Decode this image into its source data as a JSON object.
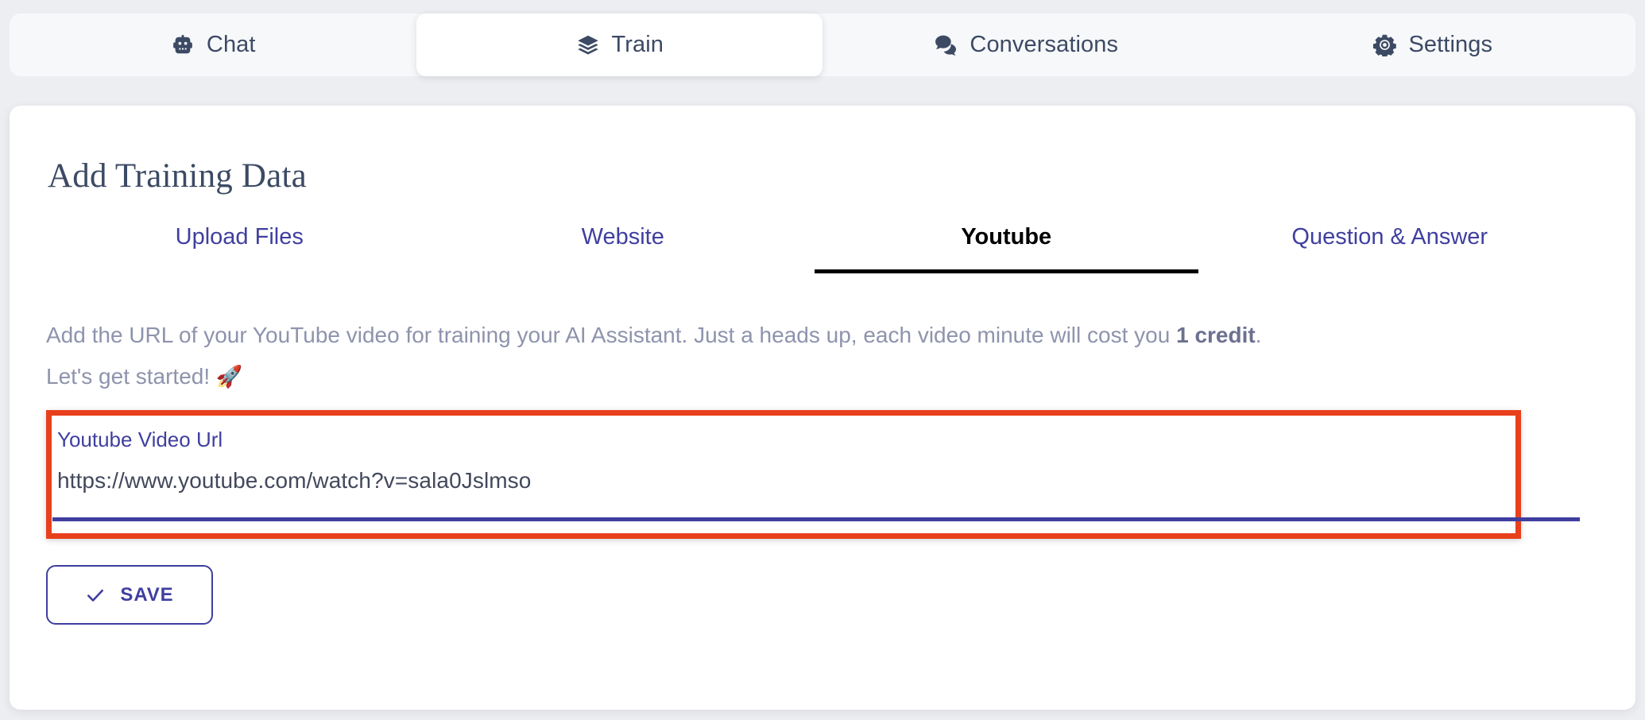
{
  "nav": {
    "tabs": [
      {
        "label": "Chat",
        "icon": "robot-icon",
        "active": false
      },
      {
        "label": "Train",
        "icon": "layers-icon",
        "active": true
      },
      {
        "label": "Conversations",
        "icon": "chat-bubbles-icon",
        "active": false
      },
      {
        "label": "Settings",
        "icon": "gear-icon",
        "active": false
      }
    ]
  },
  "main": {
    "title": "Add Training Data",
    "sub_tabs": [
      {
        "label": "Upload Files",
        "active": false
      },
      {
        "label": "Website",
        "active": false
      },
      {
        "label": "Youtube",
        "active": true
      },
      {
        "label": "Question & Answer",
        "active": false
      }
    ],
    "description": {
      "line1_before": "Add the URL of your YouTube video for training your AI Assistant. Just a heads up, each video minute will cost you ",
      "line1_bold": "1 credit",
      "line1_after": ".",
      "line2": "Let's get started! ",
      "line2_emoji": "🚀"
    },
    "url_field": {
      "label": "Youtube Video Url",
      "value": "https://www.youtube.com/watch?v=sala0Jslmso",
      "placeholder": "Youtube Video Url"
    },
    "save_button": {
      "label": "SAVE",
      "icon": "check-icon"
    }
  },
  "colors": {
    "page_background": "#edeef1",
    "card_background": "#ffffff",
    "nav_background": "#f7f8fa",
    "nav_text": "#3c4a64",
    "accent_indigo": "#3f3fa0",
    "active_tab_text": "#000000",
    "description_text": "#8e93ad",
    "highlight_border": "#e8401c",
    "input_text": "#42485c"
  }
}
